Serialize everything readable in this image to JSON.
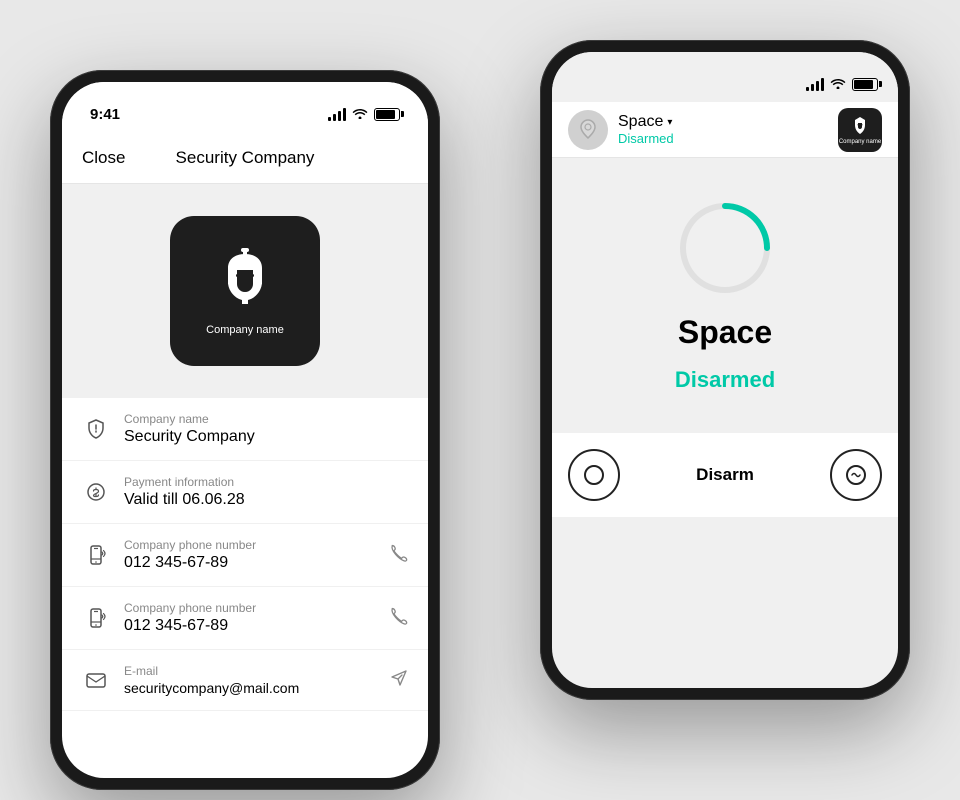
{
  "leftPhone": {
    "statusBar": {
      "time": "9:41"
    },
    "navBar": {
      "closeLabel": "Close",
      "title": "Security Company"
    },
    "companyLogo": {
      "cardLabel": "Company name"
    },
    "infoRows": [
      {
        "id": "company-name",
        "label": "Company name",
        "value": "Security Company",
        "hasAction": false,
        "iconType": "shield"
      },
      {
        "id": "payment",
        "label": "Payment information",
        "value": "Valid till 06.06.28",
        "hasAction": false,
        "iconType": "coin"
      },
      {
        "id": "phone1",
        "label": "Company phone number",
        "value": "012 345-67-89",
        "hasAction": true,
        "iconType": "phone-outline"
      },
      {
        "id": "phone2",
        "label": "Company phone number",
        "value": "012 345-67-89",
        "hasAction": true,
        "iconType": "phone-outline"
      },
      {
        "id": "email",
        "label": "E-mail",
        "value": "securitycompany@mail.com",
        "hasAction": true,
        "iconType": "email"
      }
    ]
  },
  "rightPhone": {
    "header": {
      "spaceName": "Space",
      "spaceStatus": "Disarmed",
      "companyBadgeLabel": "Company name"
    },
    "main": {
      "spaceName": "Space",
      "spaceStatus": "Disarmed"
    },
    "bottomBar": {
      "disarmLabel": "Disarm"
    }
  }
}
